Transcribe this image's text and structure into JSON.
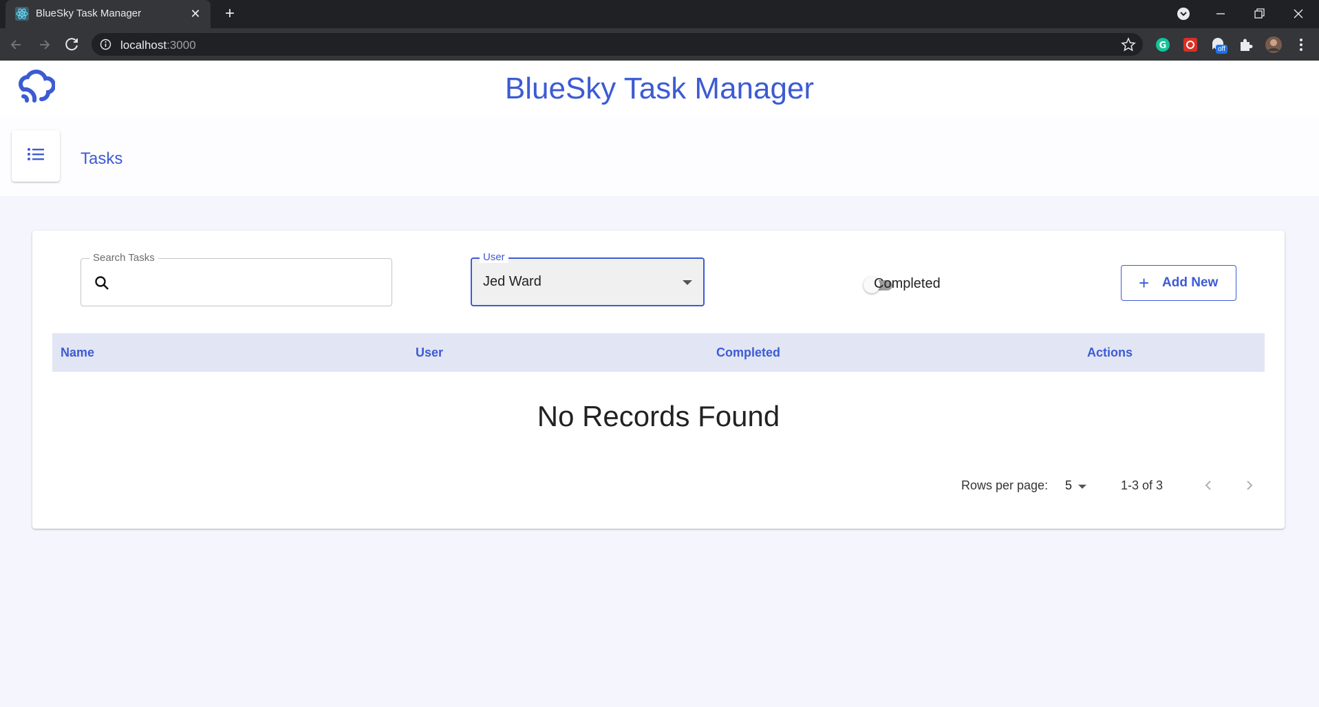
{
  "browser": {
    "tab_title": "BlueSky Task Manager",
    "url_host": "localhost",
    "url_port": ":3000",
    "extension_badge": "off"
  },
  "app": {
    "title": "BlueSky Task Manager",
    "accent_color": "#3c5bd3"
  },
  "page": {
    "title": "Tasks"
  },
  "filters": {
    "search_label": "Search Tasks",
    "search_value": "",
    "user_label": "User",
    "user_value": "Jed Ward",
    "completed_label": "Completed",
    "completed_on": false,
    "add_button_label": "Add New"
  },
  "table": {
    "columns": [
      "Name",
      "User",
      "Completed",
      "Actions"
    ],
    "empty_message": "No Records Found"
  },
  "pagination": {
    "rows_per_page_label": "Rows per page:",
    "rows_per_page": "5",
    "range": "1-3 of 3"
  }
}
